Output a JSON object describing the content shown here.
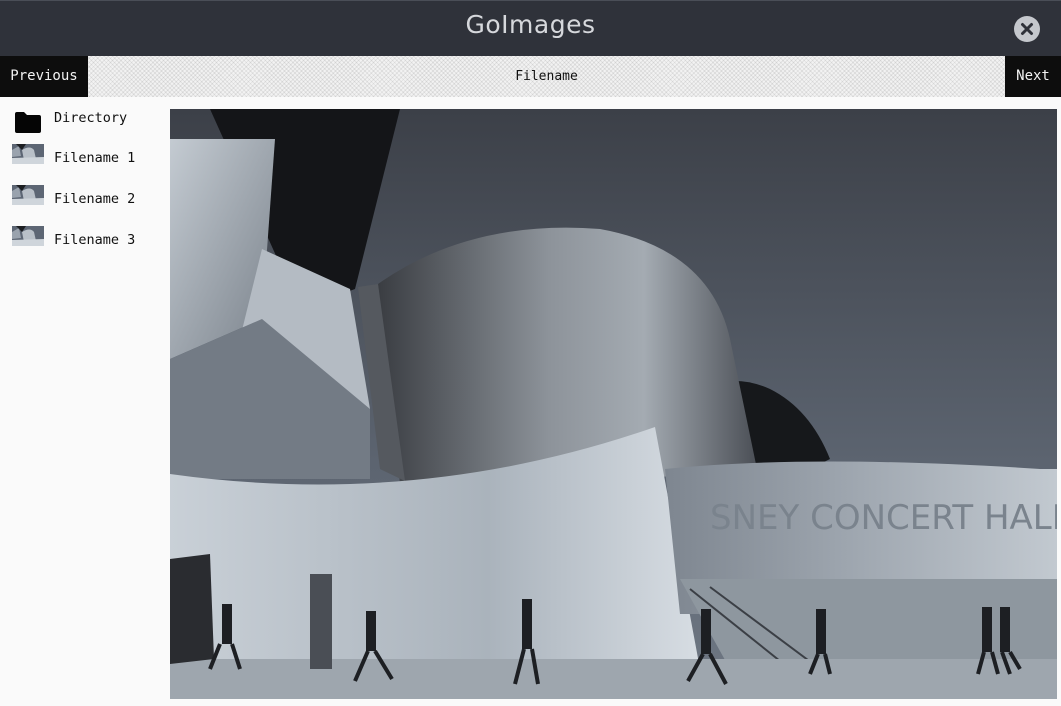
{
  "app": {
    "title": "GoImages"
  },
  "titlebar": {
    "close_icon": "close-circle-icon"
  },
  "navbar": {
    "previous_label": "Previous",
    "filename_label": "Filename",
    "next_label": "Next"
  },
  "sidebar": {
    "items": [
      {
        "label": "Directory",
        "icon": "folder-icon"
      },
      {
        "label": "Filename 1",
        "icon": "image-thumbnail"
      },
      {
        "label": "Filename 2",
        "icon": "image-thumbnail"
      },
      {
        "label": "Filename 3",
        "icon": "image-thumbnail"
      }
    ]
  },
  "colors": {
    "titlebar_bg": "#2f323a",
    "title_text": "#d6d8dc",
    "nav_button_bg": "#0d0d0d",
    "sidebar_bg": "#fafafa"
  }
}
